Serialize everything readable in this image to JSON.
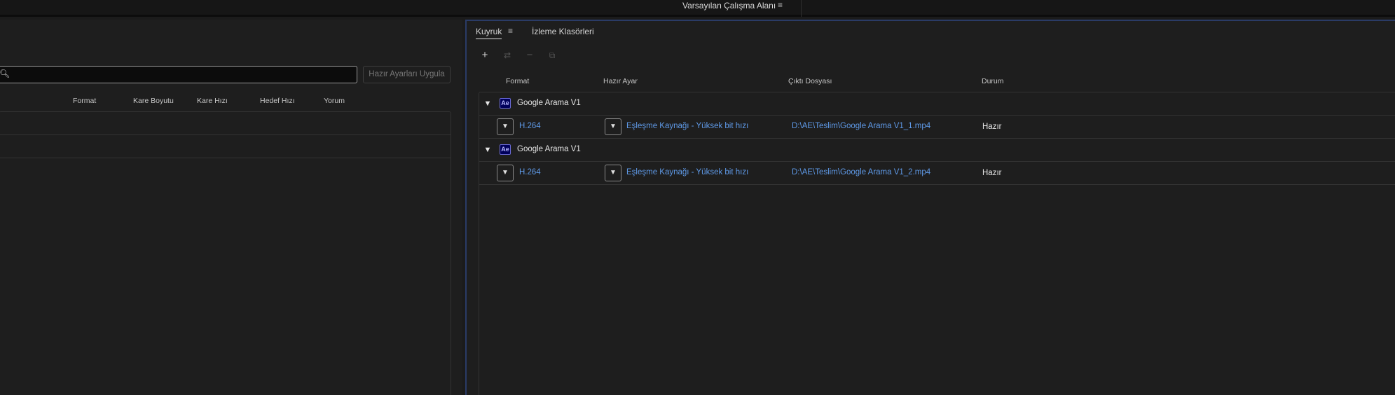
{
  "topbar": {
    "workspace_title": "Varsayılan Çalışma Alanı",
    "menu_glyph": "≡"
  },
  "left_panel": {
    "search": {
      "icon": "search-icon",
      "value": ""
    },
    "apply_presets_label": "Hazır Ayarları Uygula",
    "columns": [
      "Format",
      "Kare Boyutu",
      "Kare Hızı",
      "Hedef Hızı",
      "Yorum"
    ]
  },
  "right_panel": {
    "tabs": [
      {
        "label": "Kuyruk",
        "active": true
      },
      {
        "label": "İzleme Klasörleri",
        "active": false
      }
    ],
    "toolbar": {
      "add": {
        "icon": "plus-icon",
        "glyph": "+"
      },
      "settings": {
        "icon": "settings-icon",
        "glyph": "⇄"
      },
      "remove": {
        "icon": "minus-icon",
        "glyph": "−"
      },
      "duplicate": {
        "icon": "duplicate-icon",
        "glyph": "⧉"
      }
    },
    "columns": [
      "Format",
      "Hazır Ayar",
      "Çıktı Dosyası",
      "Durum"
    ],
    "queue": [
      {
        "name": "Google Arama V1",
        "app_badge": "Ae",
        "item": {
          "format": "H.264",
          "preset": "Eşleşme Kaynağı - Yüksek bit hızı",
          "output": "D:\\AE\\Teslim\\Google Arama V1_1.mp4",
          "status": "Hazır"
        }
      },
      {
        "name": "Google Arama V1",
        "app_badge": "Ae",
        "item": {
          "format": "H.264",
          "preset": "Eşleşme Kaynağı - Yüksek bit hızı",
          "output": "D:\\AE\\Teslim\\Google Arama V1_2.mp4",
          "status": "Hazır"
        }
      }
    ]
  },
  "colors": {
    "background": "#1e1e1e",
    "link": "#5f9ae8",
    "active_panel_border": "#2a3b66",
    "ae_badge": "#00005b"
  }
}
